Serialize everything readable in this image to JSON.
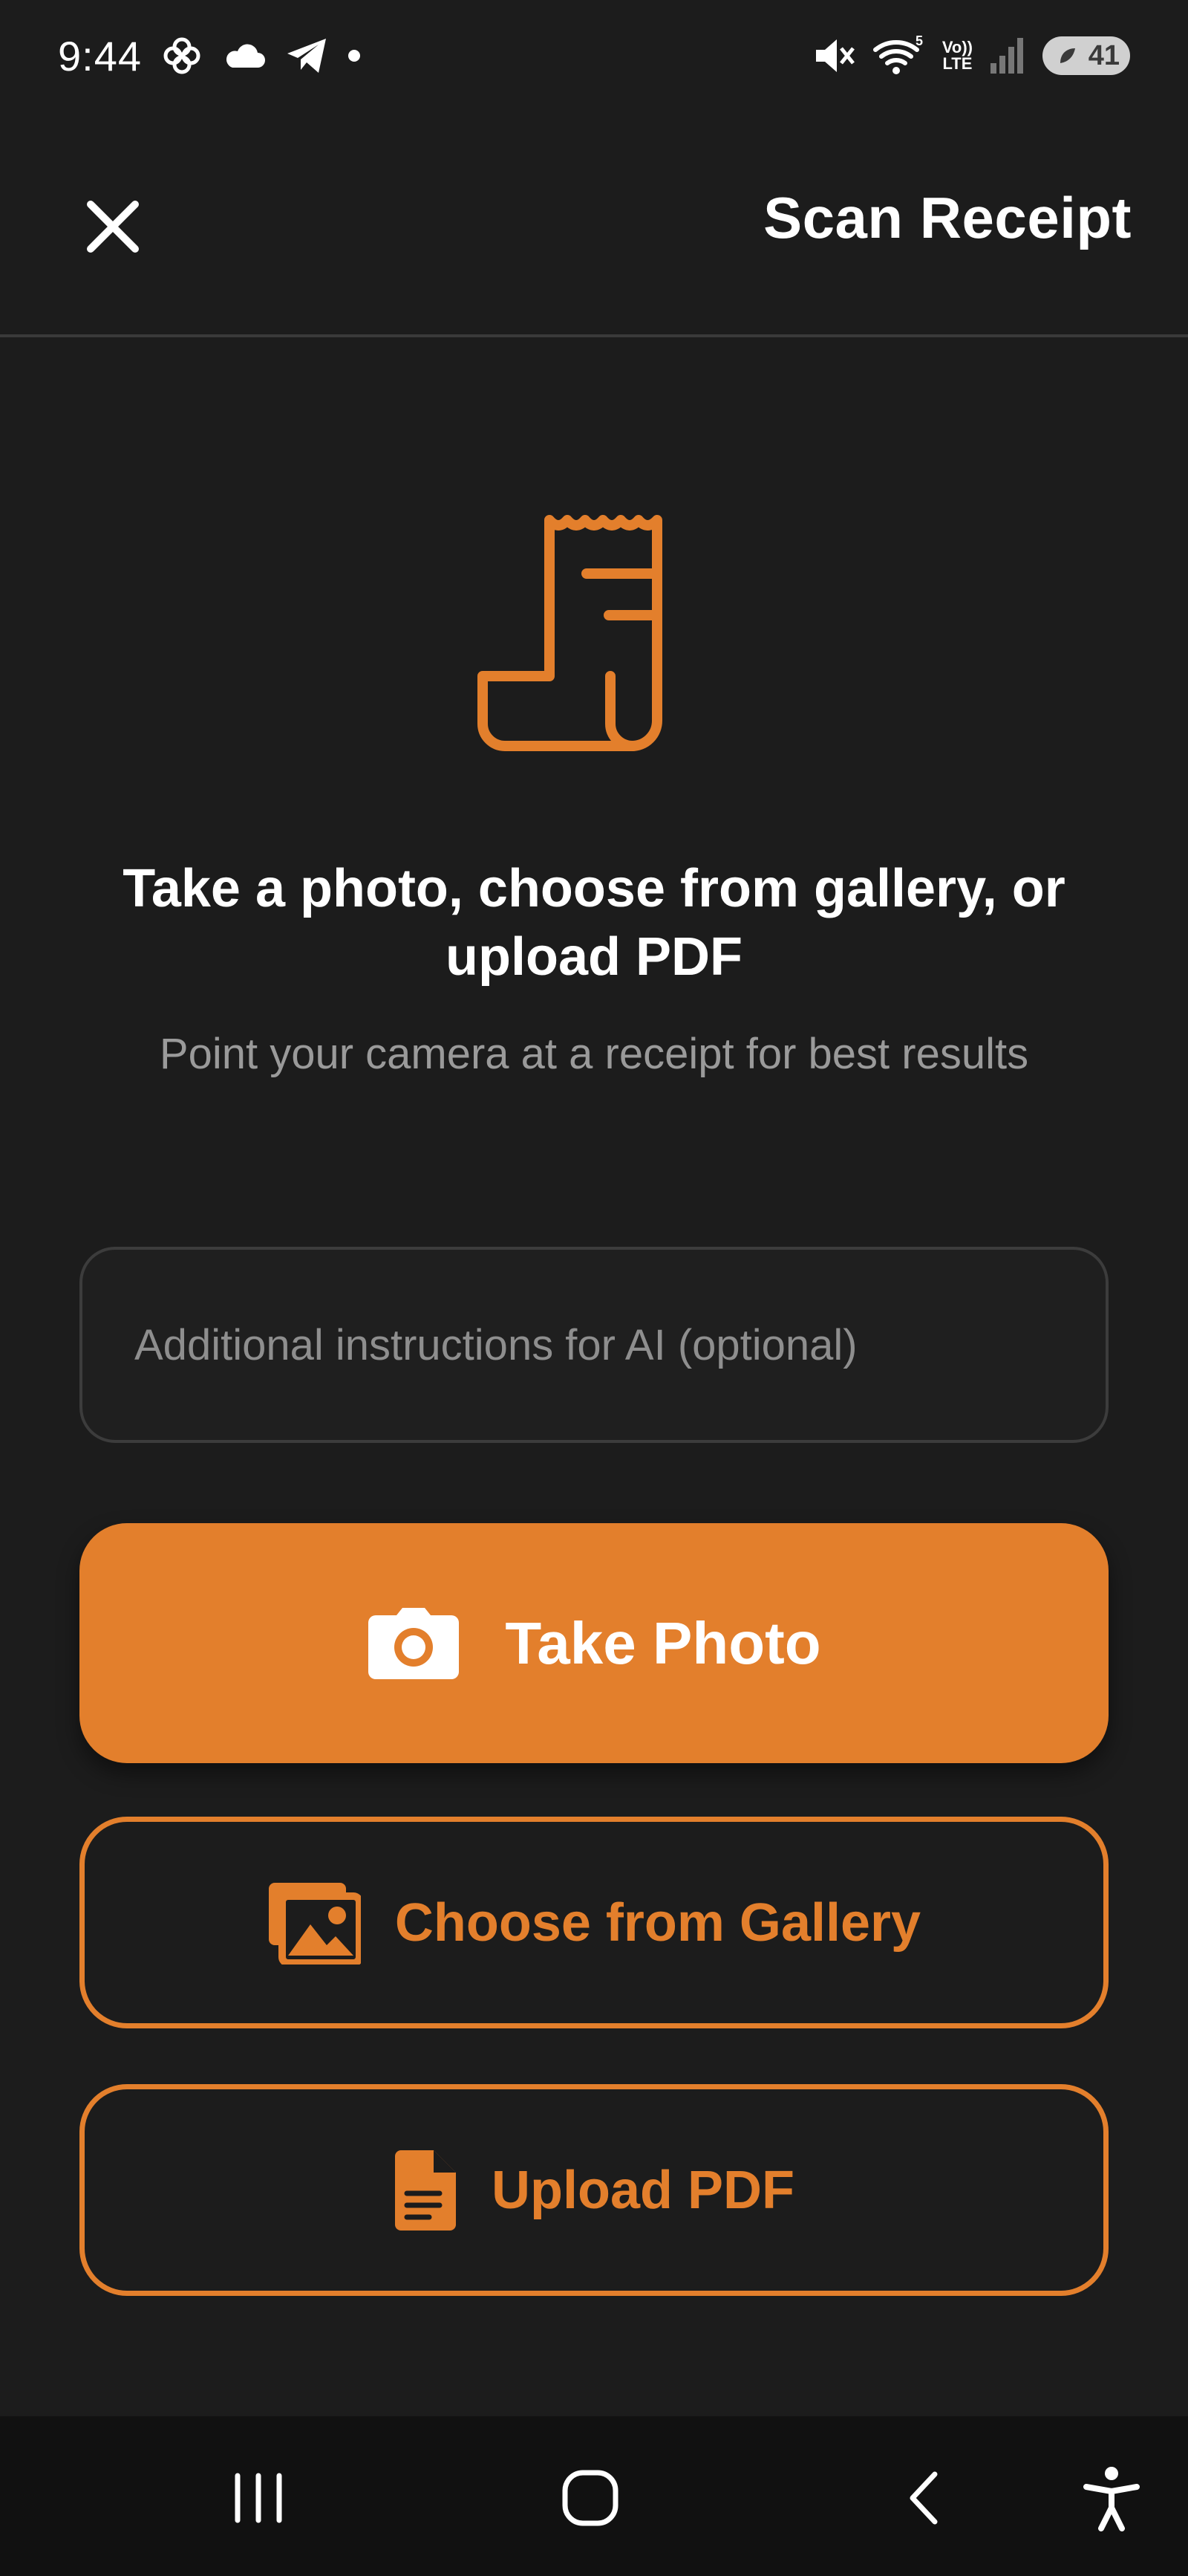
{
  "status_bar": {
    "time": "9:44",
    "network_label_top": "Vo))",
    "network_label_bottom": "LTE",
    "wifi_badge": "5",
    "battery_level": "41",
    "icons": [
      "pinwheel-icon",
      "cloud-icon",
      "telegram-icon",
      "dot-icon",
      "mute-icon",
      "wifi-icon",
      "signal-icon",
      "battery-icon"
    ]
  },
  "header": {
    "title": "Scan Receipt",
    "close_icon": "close-icon"
  },
  "hero": {
    "icon": "receipt-icon",
    "headline": "Take a photo, choose from gallery, or upload PDF",
    "subtext": "Point your camera at a receipt for best results"
  },
  "instructions": {
    "placeholder": "Additional instructions for AI (optional)",
    "value": ""
  },
  "actions": {
    "take_photo": {
      "label": "Take Photo",
      "icon": "camera-icon"
    },
    "gallery": {
      "label": "Choose from Gallery",
      "icon": "gallery-icon"
    },
    "pdf": {
      "label": "Upload PDF",
      "icon": "file-icon"
    }
  },
  "nav_bar": {
    "items": [
      "recent-apps-icon",
      "home-icon",
      "back-icon",
      "accessibility-icon"
    ]
  },
  "colors": {
    "accent": "#e37f2c",
    "background": "#1c1c1c",
    "muted_text": "#9a9a9a"
  }
}
